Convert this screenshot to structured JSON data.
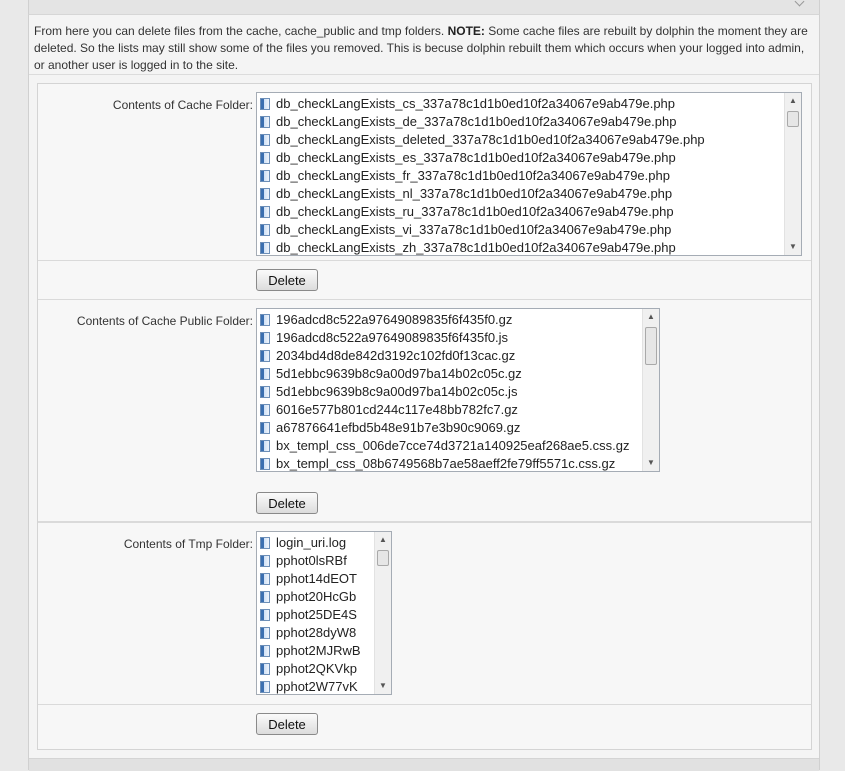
{
  "intro": {
    "text_before": "From here you can delete files from the cache, cache_public and tmp folders. ",
    "note_label": "NOTE:",
    "text_after": " Some cache files are rebuilt by dolphin the moment they are deleted. So the lists may still show some of the files you removed. This is becuse dolphin rebuilt them which occurs when your logged into admin, or another user is logged in to the site."
  },
  "cache": {
    "label": "Contents of Cache Folder:",
    "files": [
      "db_checkLangExists_cs_337a78c1d1b0ed10f2a34067e9ab479e.php",
      "db_checkLangExists_de_337a78c1d1b0ed10f2a34067e9ab479e.php",
      "db_checkLangExists_deleted_337a78c1d1b0ed10f2a34067e9ab479e.php",
      "db_checkLangExists_es_337a78c1d1b0ed10f2a34067e9ab479e.php",
      "db_checkLangExists_fr_337a78c1d1b0ed10f2a34067e9ab479e.php",
      "db_checkLangExists_nl_337a78c1d1b0ed10f2a34067e9ab479e.php",
      "db_checkLangExists_ru_337a78c1d1b0ed10f2a34067e9ab479e.php",
      "db_checkLangExists_vi_337a78c1d1b0ed10f2a34067e9ab479e.php",
      "db_checkLangExists_zh_337a78c1d1b0ed10f2a34067e9ab479e.php"
    ],
    "delete_label": "Delete"
  },
  "cache_public": {
    "label": "Contents of Cache Public Folder:",
    "files": [
      "196adcd8c522a97649089835f6f435f0.gz",
      "196adcd8c522a97649089835f6f435f0.js",
      "2034bd4d8de842d3192c102fd0f13cac.gz",
      "5d1ebbc9639b8c9a00d97ba14b02c05c.gz",
      "5d1ebbc9639b8c9a00d97ba14b02c05c.js",
      "6016e577b801cd244c117e48bb782fc7.gz",
      "a67876641efbd5b48e91b7e3b90c9069.gz",
      "bx_templ_css_006de7cce74d3721a140925eaf268ae5.css.gz",
      "bx_templ_css_08b6749568b7ae58aeff2fe79ff5571c.css.gz"
    ],
    "delete_label": "Delete"
  },
  "tmp": {
    "label": "Contents of Tmp Folder:",
    "files": [
      "login_uri.log",
      "pphot0lsRBf",
      "pphot14dEOT",
      "pphot20HcGb",
      "pphot25DE4S",
      "pphot28dyW8",
      "pphot2MJRwB",
      "pphot2QKVkp",
      "pphot2W77vK"
    ],
    "delete_label": "Delete"
  },
  "icons": {
    "file": "file-icon",
    "scroll_up": "scroll-up-arrow-icon",
    "scroll_down": "scroll-down-arrow-icon"
  },
  "colors": {
    "listbox_border": "#a5acb5",
    "page_bg": "#e9e9e9",
    "panel_bg": "#f4f4f4"
  }
}
